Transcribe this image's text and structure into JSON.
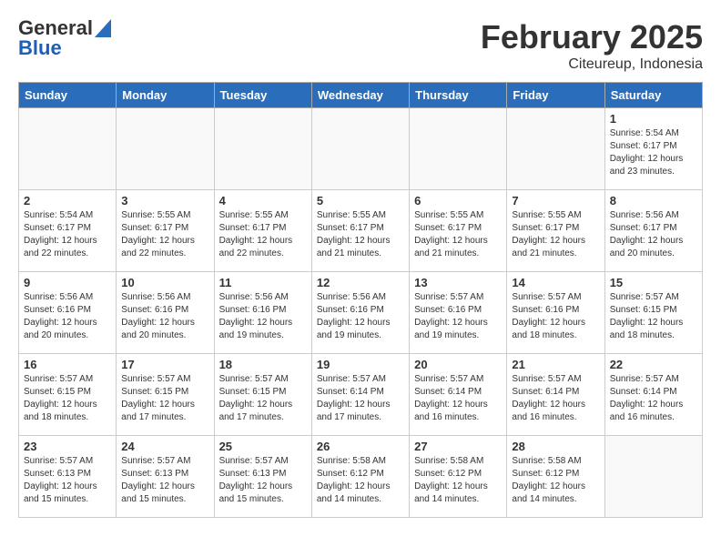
{
  "header": {
    "logo_general": "General",
    "logo_blue": "Blue",
    "month_title": "February 2025",
    "location": "Citeureup, Indonesia"
  },
  "weekdays": [
    "Sunday",
    "Monday",
    "Tuesday",
    "Wednesday",
    "Thursday",
    "Friday",
    "Saturday"
  ],
  "weeks": [
    [
      {
        "day": "",
        "info": ""
      },
      {
        "day": "",
        "info": ""
      },
      {
        "day": "",
        "info": ""
      },
      {
        "day": "",
        "info": ""
      },
      {
        "day": "",
        "info": ""
      },
      {
        "day": "",
        "info": ""
      },
      {
        "day": "1",
        "info": "Sunrise: 5:54 AM\nSunset: 6:17 PM\nDaylight: 12 hours\nand 23 minutes."
      }
    ],
    [
      {
        "day": "2",
        "info": "Sunrise: 5:54 AM\nSunset: 6:17 PM\nDaylight: 12 hours\nand 22 minutes."
      },
      {
        "day": "3",
        "info": "Sunrise: 5:55 AM\nSunset: 6:17 PM\nDaylight: 12 hours\nand 22 minutes."
      },
      {
        "day": "4",
        "info": "Sunrise: 5:55 AM\nSunset: 6:17 PM\nDaylight: 12 hours\nand 22 minutes."
      },
      {
        "day": "5",
        "info": "Sunrise: 5:55 AM\nSunset: 6:17 PM\nDaylight: 12 hours\nand 21 minutes."
      },
      {
        "day": "6",
        "info": "Sunrise: 5:55 AM\nSunset: 6:17 PM\nDaylight: 12 hours\nand 21 minutes."
      },
      {
        "day": "7",
        "info": "Sunrise: 5:55 AM\nSunset: 6:17 PM\nDaylight: 12 hours\nand 21 minutes."
      },
      {
        "day": "8",
        "info": "Sunrise: 5:56 AM\nSunset: 6:17 PM\nDaylight: 12 hours\nand 20 minutes."
      }
    ],
    [
      {
        "day": "9",
        "info": "Sunrise: 5:56 AM\nSunset: 6:16 PM\nDaylight: 12 hours\nand 20 minutes."
      },
      {
        "day": "10",
        "info": "Sunrise: 5:56 AM\nSunset: 6:16 PM\nDaylight: 12 hours\nand 20 minutes."
      },
      {
        "day": "11",
        "info": "Sunrise: 5:56 AM\nSunset: 6:16 PM\nDaylight: 12 hours\nand 19 minutes."
      },
      {
        "day": "12",
        "info": "Sunrise: 5:56 AM\nSunset: 6:16 PM\nDaylight: 12 hours\nand 19 minutes."
      },
      {
        "day": "13",
        "info": "Sunrise: 5:57 AM\nSunset: 6:16 PM\nDaylight: 12 hours\nand 19 minutes."
      },
      {
        "day": "14",
        "info": "Sunrise: 5:57 AM\nSunset: 6:16 PM\nDaylight: 12 hours\nand 18 minutes."
      },
      {
        "day": "15",
        "info": "Sunrise: 5:57 AM\nSunset: 6:15 PM\nDaylight: 12 hours\nand 18 minutes."
      }
    ],
    [
      {
        "day": "16",
        "info": "Sunrise: 5:57 AM\nSunset: 6:15 PM\nDaylight: 12 hours\nand 18 minutes."
      },
      {
        "day": "17",
        "info": "Sunrise: 5:57 AM\nSunset: 6:15 PM\nDaylight: 12 hours\nand 17 minutes."
      },
      {
        "day": "18",
        "info": "Sunrise: 5:57 AM\nSunset: 6:15 PM\nDaylight: 12 hours\nand 17 minutes."
      },
      {
        "day": "19",
        "info": "Sunrise: 5:57 AM\nSunset: 6:14 PM\nDaylight: 12 hours\nand 17 minutes."
      },
      {
        "day": "20",
        "info": "Sunrise: 5:57 AM\nSunset: 6:14 PM\nDaylight: 12 hours\nand 16 minutes."
      },
      {
        "day": "21",
        "info": "Sunrise: 5:57 AM\nSunset: 6:14 PM\nDaylight: 12 hours\nand 16 minutes."
      },
      {
        "day": "22",
        "info": "Sunrise: 5:57 AM\nSunset: 6:14 PM\nDaylight: 12 hours\nand 16 minutes."
      }
    ],
    [
      {
        "day": "23",
        "info": "Sunrise: 5:57 AM\nSunset: 6:13 PM\nDaylight: 12 hours\nand 15 minutes."
      },
      {
        "day": "24",
        "info": "Sunrise: 5:57 AM\nSunset: 6:13 PM\nDaylight: 12 hours\nand 15 minutes."
      },
      {
        "day": "25",
        "info": "Sunrise: 5:57 AM\nSunset: 6:13 PM\nDaylight: 12 hours\nand 15 minutes."
      },
      {
        "day": "26",
        "info": "Sunrise: 5:58 AM\nSunset: 6:12 PM\nDaylight: 12 hours\nand 14 minutes."
      },
      {
        "day": "27",
        "info": "Sunrise: 5:58 AM\nSunset: 6:12 PM\nDaylight: 12 hours\nand 14 minutes."
      },
      {
        "day": "28",
        "info": "Sunrise: 5:58 AM\nSunset: 6:12 PM\nDaylight: 12 hours\nand 14 minutes."
      },
      {
        "day": "",
        "info": ""
      }
    ]
  ]
}
